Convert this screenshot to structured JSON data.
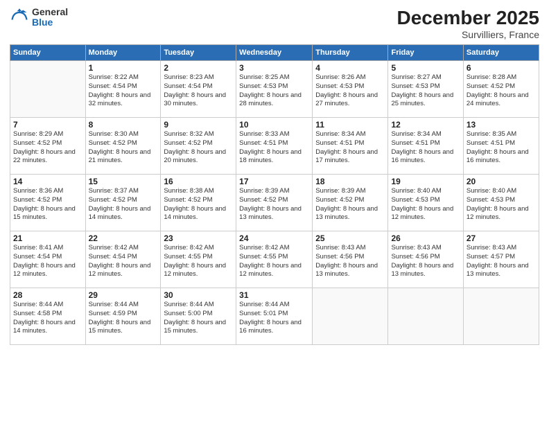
{
  "logo": {
    "general": "General",
    "blue": "Blue"
  },
  "title": "December 2025",
  "subtitle": "Survilliers, France",
  "header_days": [
    "Sunday",
    "Monday",
    "Tuesday",
    "Wednesday",
    "Thursday",
    "Friday",
    "Saturday"
  ],
  "weeks": [
    [
      {
        "day": "",
        "sunrise": "",
        "sunset": "",
        "daylight": ""
      },
      {
        "day": "1",
        "sunrise": "Sunrise: 8:22 AM",
        "sunset": "Sunset: 4:54 PM",
        "daylight": "Daylight: 8 hours and 32 minutes."
      },
      {
        "day": "2",
        "sunrise": "Sunrise: 8:23 AM",
        "sunset": "Sunset: 4:54 PM",
        "daylight": "Daylight: 8 hours and 30 minutes."
      },
      {
        "day": "3",
        "sunrise": "Sunrise: 8:25 AM",
        "sunset": "Sunset: 4:53 PM",
        "daylight": "Daylight: 8 hours and 28 minutes."
      },
      {
        "day": "4",
        "sunrise": "Sunrise: 8:26 AM",
        "sunset": "Sunset: 4:53 PM",
        "daylight": "Daylight: 8 hours and 27 minutes."
      },
      {
        "day": "5",
        "sunrise": "Sunrise: 8:27 AM",
        "sunset": "Sunset: 4:53 PM",
        "daylight": "Daylight: 8 hours and 25 minutes."
      },
      {
        "day": "6",
        "sunrise": "Sunrise: 8:28 AM",
        "sunset": "Sunset: 4:52 PM",
        "daylight": "Daylight: 8 hours and 24 minutes."
      }
    ],
    [
      {
        "day": "7",
        "sunrise": "Sunrise: 8:29 AM",
        "sunset": "Sunset: 4:52 PM",
        "daylight": "Daylight: 8 hours and 22 minutes."
      },
      {
        "day": "8",
        "sunrise": "Sunrise: 8:30 AM",
        "sunset": "Sunset: 4:52 PM",
        "daylight": "Daylight: 8 hours and 21 minutes."
      },
      {
        "day": "9",
        "sunrise": "Sunrise: 8:32 AM",
        "sunset": "Sunset: 4:52 PM",
        "daylight": "Daylight: 8 hours and 20 minutes."
      },
      {
        "day": "10",
        "sunrise": "Sunrise: 8:33 AM",
        "sunset": "Sunset: 4:51 PM",
        "daylight": "Daylight: 8 hours and 18 minutes."
      },
      {
        "day": "11",
        "sunrise": "Sunrise: 8:34 AM",
        "sunset": "Sunset: 4:51 PM",
        "daylight": "Daylight: 8 hours and 17 minutes."
      },
      {
        "day": "12",
        "sunrise": "Sunrise: 8:34 AM",
        "sunset": "Sunset: 4:51 PM",
        "daylight": "Daylight: 8 hours and 16 minutes."
      },
      {
        "day": "13",
        "sunrise": "Sunrise: 8:35 AM",
        "sunset": "Sunset: 4:51 PM",
        "daylight": "Daylight: 8 hours and 16 minutes."
      }
    ],
    [
      {
        "day": "14",
        "sunrise": "Sunrise: 8:36 AM",
        "sunset": "Sunset: 4:52 PM",
        "daylight": "Daylight: 8 hours and 15 minutes."
      },
      {
        "day": "15",
        "sunrise": "Sunrise: 8:37 AM",
        "sunset": "Sunset: 4:52 PM",
        "daylight": "Daylight: 8 hours and 14 minutes."
      },
      {
        "day": "16",
        "sunrise": "Sunrise: 8:38 AM",
        "sunset": "Sunset: 4:52 PM",
        "daylight": "Daylight: 8 hours and 14 minutes."
      },
      {
        "day": "17",
        "sunrise": "Sunrise: 8:39 AM",
        "sunset": "Sunset: 4:52 PM",
        "daylight": "Daylight: 8 hours and 13 minutes."
      },
      {
        "day": "18",
        "sunrise": "Sunrise: 8:39 AM",
        "sunset": "Sunset: 4:52 PM",
        "daylight": "Daylight: 8 hours and 13 minutes."
      },
      {
        "day": "19",
        "sunrise": "Sunrise: 8:40 AM",
        "sunset": "Sunset: 4:53 PM",
        "daylight": "Daylight: 8 hours and 12 minutes."
      },
      {
        "day": "20",
        "sunrise": "Sunrise: 8:40 AM",
        "sunset": "Sunset: 4:53 PM",
        "daylight": "Daylight: 8 hours and 12 minutes."
      }
    ],
    [
      {
        "day": "21",
        "sunrise": "Sunrise: 8:41 AM",
        "sunset": "Sunset: 4:54 PM",
        "daylight": "Daylight: 8 hours and 12 minutes."
      },
      {
        "day": "22",
        "sunrise": "Sunrise: 8:42 AM",
        "sunset": "Sunset: 4:54 PM",
        "daylight": "Daylight: 8 hours and 12 minutes."
      },
      {
        "day": "23",
        "sunrise": "Sunrise: 8:42 AM",
        "sunset": "Sunset: 4:55 PM",
        "daylight": "Daylight: 8 hours and 12 minutes."
      },
      {
        "day": "24",
        "sunrise": "Sunrise: 8:42 AM",
        "sunset": "Sunset: 4:55 PM",
        "daylight": "Daylight: 8 hours and 12 minutes."
      },
      {
        "day": "25",
        "sunrise": "Sunrise: 8:43 AM",
        "sunset": "Sunset: 4:56 PM",
        "daylight": "Daylight: 8 hours and 13 minutes."
      },
      {
        "day": "26",
        "sunrise": "Sunrise: 8:43 AM",
        "sunset": "Sunset: 4:56 PM",
        "daylight": "Daylight: 8 hours and 13 minutes."
      },
      {
        "day": "27",
        "sunrise": "Sunrise: 8:43 AM",
        "sunset": "Sunset: 4:57 PM",
        "daylight": "Daylight: 8 hours and 13 minutes."
      }
    ],
    [
      {
        "day": "28",
        "sunrise": "Sunrise: 8:44 AM",
        "sunset": "Sunset: 4:58 PM",
        "daylight": "Daylight: 8 hours and 14 minutes."
      },
      {
        "day": "29",
        "sunrise": "Sunrise: 8:44 AM",
        "sunset": "Sunset: 4:59 PM",
        "daylight": "Daylight: 8 hours and 15 minutes."
      },
      {
        "day": "30",
        "sunrise": "Sunrise: 8:44 AM",
        "sunset": "Sunset: 5:00 PM",
        "daylight": "Daylight: 8 hours and 15 minutes."
      },
      {
        "day": "31",
        "sunrise": "Sunrise: 8:44 AM",
        "sunset": "Sunset: 5:01 PM",
        "daylight": "Daylight: 8 hours and 16 minutes."
      },
      {
        "day": "",
        "sunrise": "",
        "sunset": "",
        "daylight": ""
      },
      {
        "day": "",
        "sunrise": "",
        "sunset": "",
        "daylight": ""
      },
      {
        "day": "",
        "sunrise": "",
        "sunset": "",
        "daylight": ""
      }
    ]
  ]
}
